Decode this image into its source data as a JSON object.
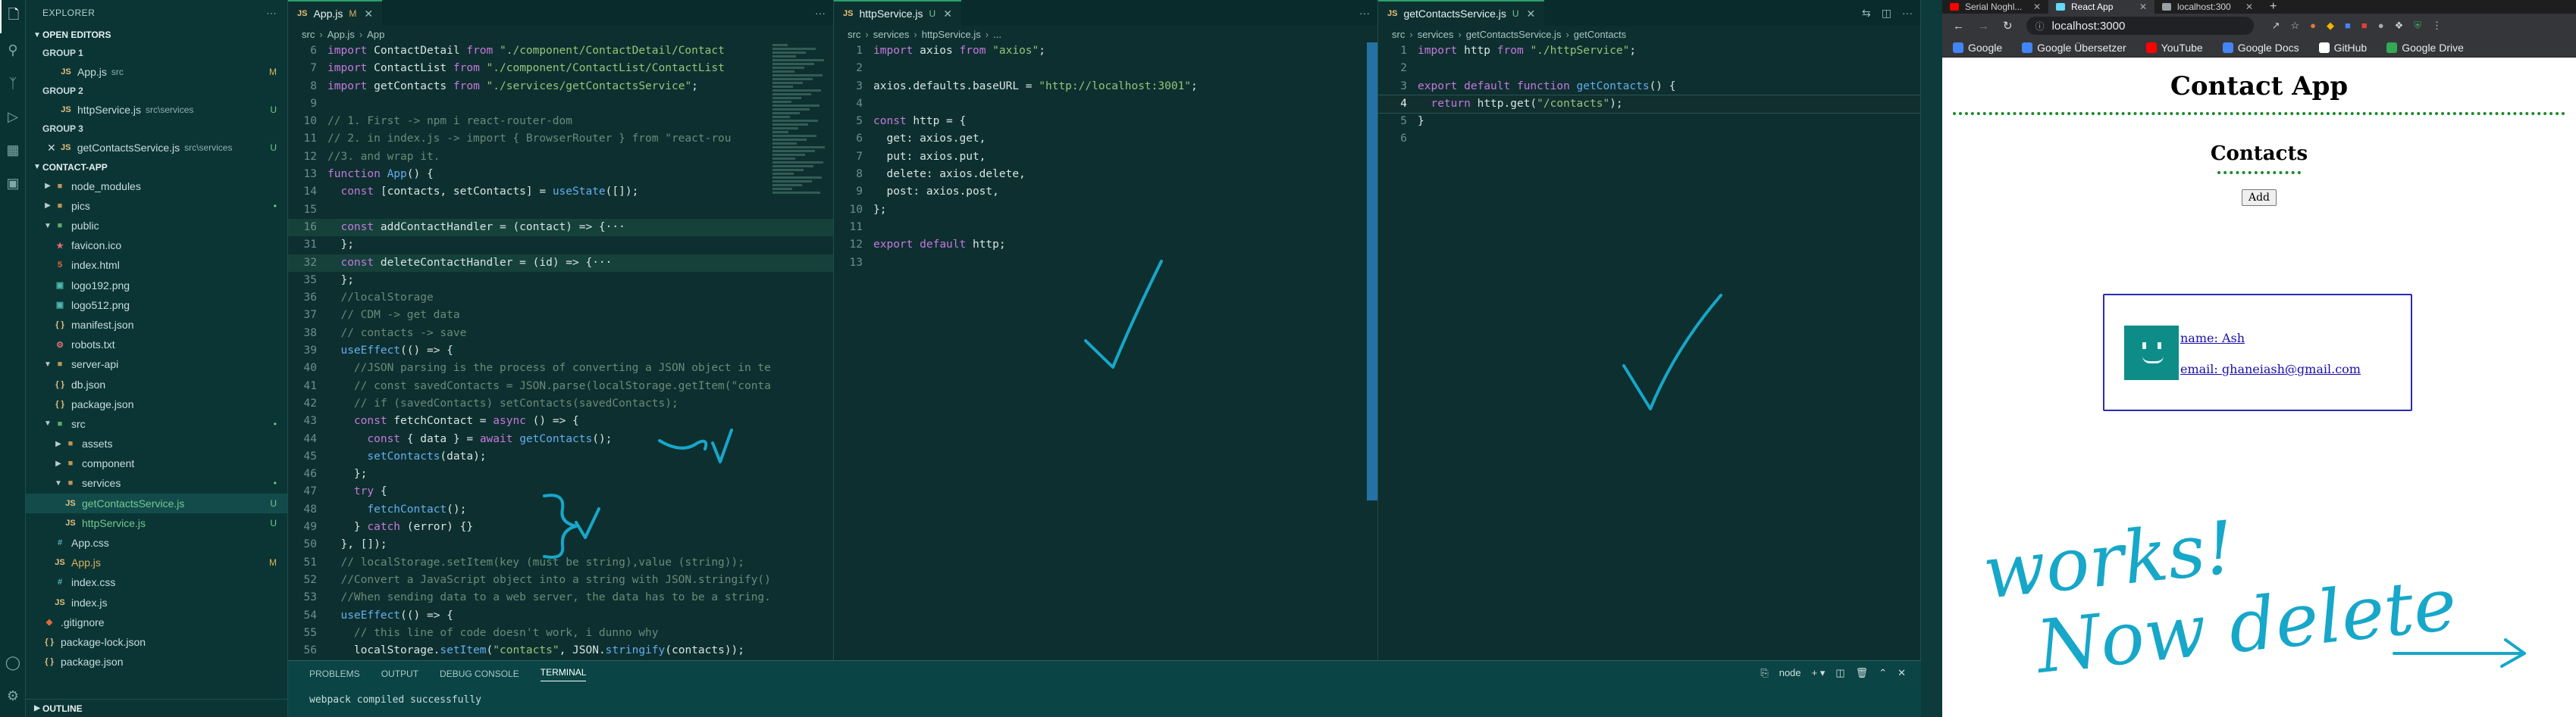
{
  "activity_bar": [
    "files-icon",
    "search-icon",
    "source-control-icon",
    "run-debug-icon",
    "extensions-icon",
    "remote-icon",
    "accounts-icon",
    "settings-icon"
  ],
  "explorer": {
    "title": "EXPLORER",
    "more": "···",
    "open_editors_label": "OPEN EDITORS",
    "groups": [
      {
        "label": "GROUP 1",
        "file": "App.js",
        "desc": "src",
        "status": "M"
      },
      {
        "label": "GROUP 2",
        "file": "httpService.js",
        "desc": "src\\services",
        "status": "U"
      },
      {
        "label": "GROUP 3",
        "file": "getContactsService.js",
        "desc": "src\\services",
        "status": "U"
      }
    ],
    "project_label": "CONTACT-APP",
    "tree": [
      {
        "name": "node_modules",
        "type": "folder-collapsed",
        "indent": 0
      },
      {
        "name": "pics",
        "type": "folder-collapsed",
        "indent": 0,
        "badge": "•"
      },
      {
        "name": "public",
        "type": "folder-open",
        "indent": 0
      },
      {
        "name": "favicon.ico",
        "type": "file-ico",
        "indent": 1
      },
      {
        "name": "index.html",
        "type": "file-html",
        "indent": 1
      },
      {
        "name": "logo192.png",
        "type": "file-img",
        "indent": 1
      },
      {
        "name": "logo512.png",
        "type": "file-img",
        "indent": 1
      },
      {
        "name": "manifest.json",
        "type": "file-json",
        "indent": 1
      },
      {
        "name": "robots.txt",
        "type": "file-txt",
        "indent": 1
      },
      {
        "name": "server-api",
        "type": "folder-open",
        "indent": 0
      },
      {
        "name": "db.json",
        "type": "file-json",
        "indent": 1
      },
      {
        "name": "package.json",
        "type": "file-json",
        "indent": 1
      },
      {
        "name": "src",
        "type": "folder-open",
        "indent": 0,
        "badge": "•"
      },
      {
        "name": "assets",
        "type": "folder-collapsed",
        "indent": 1
      },
      {
        "name": "component",
        "type": "folder-collapsed",
        "indent": 1
      },
      {
        "name": "services",
        "type": "folder-open",
        "indent": 1,
        "badge": "•"
      },
      {
        "name": "getContactsService.js",
        "type": "file-js",
        "indent": 2,
        "badge": "U",
        "selected": true
      },
      {
        "name": "httpService.js",
        "type": "file-js",
        "indent": 2,
        "badge": "U"
      },
      {
        "name": "App.css",
        "type": "file-css",
        "indent": 1
      },
      {
        "name": "App.js",
        "type": "file-js",
        "indent": 1,
        "badge": "M"
      },
      {
        "name": "index.css",
        "type": "file-css",
        "indent": 1
      },
      {
        "name": "index.js",
        "type": "file-js",
        "indent": 1
      },
      {
        "name": ".gitignore",
        "type": "file-git",
        "indent": 0
      },
      {
        "name": "package-lock.json",
        "type": "file-json",
        "indent": 0
      },
      {
        "name": "package.json",
        "type": "file-json",
        "indent": 0
      }
    ],
    "outline_label": "OUTLINE"
  },
  "editor1": {
    "tab": "App.js",
    "tab_status": "M",
    "crumbs": [
      "src",
      "App.js",
      "App"
    ],
    "lines": [
      {
        "n": "6",
        "t": "import ContactDetail from \"./component/ContactDetail/Contact"
      },
      {
        "n": "7",
        "t": "import ContactList from \"./component/ContactList/ContactList"
      },
      {
        "n": "8",
        "t": "import getContacts from \"./services/getContactsService\";"
      },
      {
        "n": "9",
        "t": ""
      },
      {
        "n": "10",
        "t": "// 1. First -> npm i react-router-dom"
      },
      {
        "n": "11",
        "t": "// 2. in index.js -> import { BrowserRouter } from \"react-rou"
      },
      {
        "n": "12",
        "t": "//3. and wrap it."
      },
      {
        "n": "13",
        "t": "function App() {"
      },
      {
        "n": "14",
        "t": "  const [contacts, setContacts] = useState([]);"
      },
      {
        "n": "15",
        "t": ""
      },
      {
        "n": "16",
        "t": "  const addContactHandler = (contact) => {···",
        "fold": true
      },
      {
        "n": "31",
        "t": "  };"
      },
      {
        "n": "32",
        "t": "  const deleteContactHandler = (id) => {···",
        "fold": true
      },
      {
        "n": "35",
        "t": "  };"
      },
      {
        "n": "36",
        "t": "  //localStorage"
      },
      {
        "n": "37",
        "t": "  // CDM -> get data"
      },
      {
        "n": "38",
        "t": "  // contacts -> save"
      },
      {
        "n": "39",
        "t": "  useEffect(() => {"
      },
      {
        "n": "40",
        "t": "    //JSON parsing is the process of converting a JSON object in te"
      },
      {
        "n": "41",
        "t": "    // const savedContacts = JSON.parse(localStorage.getItem(\"conta"
      },
      {
        "n": "42",
        "t": "    // if (savedContacts) setContacts(savedContacts);"
      },
      {
        "n": "43",
        "t": "    const fetchContact = async () => {"
      },
      {
        "n": "44",
        "t": "      const { data } = await getContacts();"
      },
      {
        "n": "45",
        "t": "      setContacts(data);"
      },
      {
        "n": "46",
        "t": "    };"
      },
      {
        "n": "47",
        "t": "    try {"
      },
      {
        "n": "48",
        "t": "      fetchContact();"
      },
      {
        "n": "49",
        "t": "    } catch (error) {}"
      },
      {
        "n": "50",
        "t": "  }, []);"
      },
      {
        "n": "51",
        "t": "  // localStorage.setItem(key (must be string),value (string));"
      },
      {
        "n": "52",
        "t": "  //Convert a JavaScript object into a string with JSON.stringify()"
      },
      {
        "n": "53",
        "t": "  //When sending data to a web server, the data has to be a string."
      },
      {
        "n": "54",
        "t": "  useEffect(() => {"
      },
      {
        "n": "55",
        "t": "    // this line of code doesn't work, i dunno why"
      },
      {
        "n": "56",
        "t": "    localStorage.setItem(\"contacts\", JSON.stringify(contacts));"
      }
    ]
  },
  "editor2": {
    "tab": "httpService.js",
    "tab_status": "U",
    "crumbs": [
      "src",
      "services",
      "httpService.js",
      "..."
    ],
    "lines": [
      {
        "n": "1",
        "t": "import axios from \"axios\";"
      },
      {
        "n": "2",
        "t": ""
      },
      {
        "n": "3",
        "t": "axios.defaults.baseURL = \"http://localhost:3001\";"
      },
      {
        "n": "4",
        "t": ""
      },
      {
        "n": "5",
        "t": "const http = {"
      },
      {
        "n": "6",
        "t": "  get: axios.get,"
      },
      {
        "n": "7",
        "t": "  put: axios.put,"
      },
      {
        "n": "8",
        "t": "  delete: axios.delete,"
      },
      {
        "n": "9",
        "t": "  post: axios.post,"
      },
      {
        "n": "10",
        "t": "};"
      },
      {
        "n": "11",
        "t": ""
      },
      {
        "n": "12",
        "t": "export default http;"
      },
      {
        "n": "13",
        "t": ""
      }
    ]
  },
  "editor3": {
    "tab": "getContactsService.js",
    "tab_status": "U",
    "crumbs": [
      "src",
      "services",
      "getContactsService.js",
      "getContacts"
    ],
    "lines": [
      {
        "n": "1",
        "t": "import http from \"./httpService\";"
      },
      {
        "n": "2",
        "t": ""
      },
      {
        "n": "3",
        "t": "export default function getContacts() {"
      },
      {
        "n": "4",
        "t": "  return http.get(\"/contacts\");",
        "current": true
      },
      {
        "n": "5",
        "t": "}"
      },
      {
        "n": "6",
        "t": ""
      }
    ]
  },
  "panel": {
    "tabs": [
      "PROBLEMS",
      "OUTPUT",
      "DEBUG CONSOLE",
      "TERMINAL"
    ],
    "active_tab": "TERMINAL",
    "terminal_name": "node",
    "terminal_text": "webpack compiled successfully"
  },
  "browser": {
    "tabs": [
      {
        "title": "Serial Noghl...",
        "color": "#ff0000"
      },
      {
        "title": "React App",
        "color": "#61dafb",
        "active": true
      },
      {
        "title": "localhost:300",
        "color": "#9aa0a6"
      }
    ],
    "new_tab": "+",
    "url": "localhost:3000",
    "bookmarks": [
      {
        "label": "Google",
        "color": "#4285f4"
      },
      {
        "label": "Google Übersetzer",
        "color": "#4285f4"
      },
      {
        "label": "YouTube",
        "color": "#ff0000"
      },
      {
        "label": "Google Docs",
        "color": "#4285f4"
      },
      {
        "label": "GitHub",
        "color": "#ffffff"
      },
      {
        "label": "Google Drive",
        "color": "#34a853"
      }
    ],
    "page": {
      "title": "Contact App",
      "section": "Contacts",
      "add_button": "Add",
      "contact": {
        "name": "name: Ash",
        "email": "email: ghaneiash@gmail.com"
      }
    }
  },
  "annotations": {
    "handwriting": "works!\nNow delete",
    "ink_color": "#17a7c9"
  }
}
